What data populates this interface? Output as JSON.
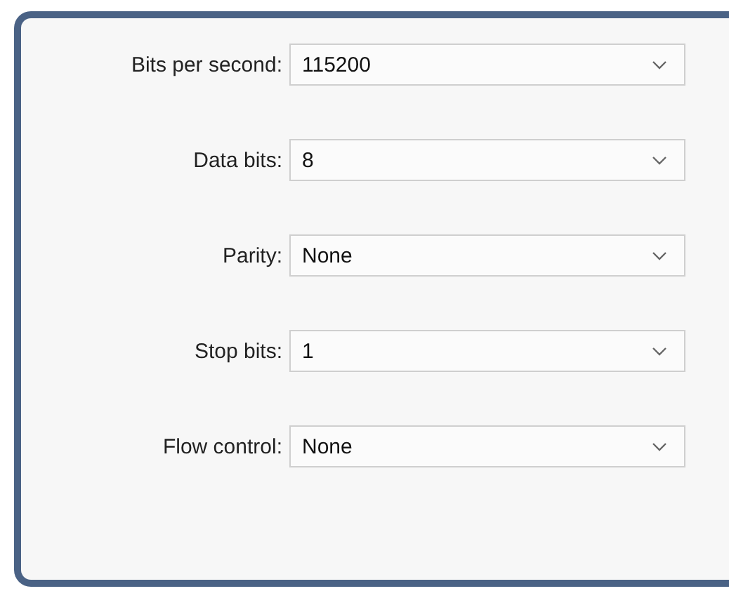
{
  "fields": [
    {
      "label": "Bits per second:",
      "value": "115200"
    },
    {
      "label": "Data bits:",
      "value": "8"
    },
    {
      "label": "Parity:",
      "value": "None"
    },
    {
      "label": "Stop bits:",
      "value": "1"
    },
    {
      "label": "Flow control:",
      "value": "None"
    }
  ]
}
